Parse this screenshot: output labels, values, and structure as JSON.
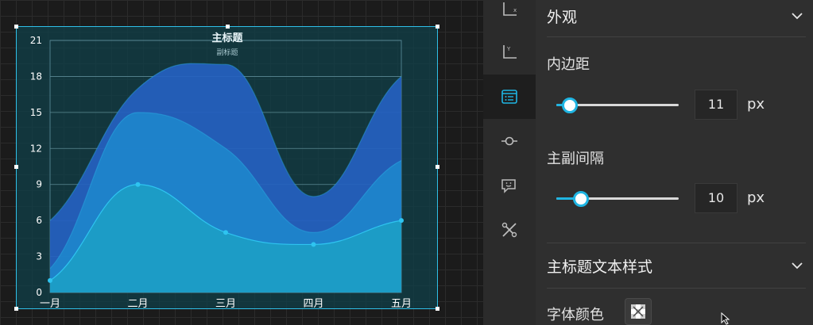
{
  "chart": {
    "title": "主标题",
    "subtitle": "副标题"
  },
  "chart_data": {
    "type": "area",
    "title": "主标题",
    "subtitle": "副标题",
    "categories": [
      "一月",
      "二月",
      "三月",
      "四月",
      "五月"
    ],
    "ylim": [
      0,
      21
    ],
    "yticks": [
      0,
      3,
      6,
      9,
      12,
      15,
      18,
      21
    ],
    "stacked": true,
    "series": [
      {
        "values": [
          1,
          9,
          5,
          4,
          6
        ],
        "color": "#1c9ec6"
      },
      {
        "values": [
          1,
          6,
          7,
          1,
          5
        ],
        "color": "#1e86cc"
      },
      {
        "values": [
          4,
          2,
          7,
          3,
          7
        ],
        "color": "#2561c0"
      }
    ],
    "grid": true
  },
  "rail": {
    "items": [
      {
        "icon": "x-axis-icon"
      },
      {
        "icon": "y-axis-icon"
      },
      {
        "icon": "legend-icon"
      },
      {
        "icon": "series-icon"
      },
      {
        "icon": "tooltip-icon"
      },
      {
        "icon": "tools-icon"
      }
    ],
    "active_index": 2
  },
  "panel": {
    "appearance_header": "外观",
    "padding_label": "内边距",
    "padding_value": "11",
    "padding_slider": 0.11,
    "padding_unit": "px",
    "gap_label": "主副间隔",
    "gap_value": "10",
    "gap_slider": 0.2,
    "gap_unit": "px",
    "title_style_header": "主标题文本样式",
    "font_color_label": "字体颜色"
  },
  "colors": {
    "accent": "#1fb5e3",
    "frame_border": "#2fc0e8"
  }
}
